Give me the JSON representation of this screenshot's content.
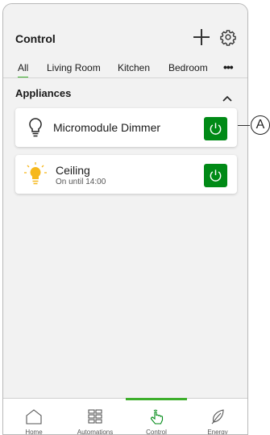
{
  "header": {
    "title": "Control"
  },
  "icons": {
    "add": "plus-icon",
    "settings": "gear-icon",
    "more": "more-dots-icon",
    "collapse": "chevron-up-icon"
  },
  "tabs": [
    {
      "label": "All",
      "active": true
    },
    {
      "label": "Living Room",
      "active": false
    },
    {
      "label": "Kitchen",
      "active": false
    },
    {
      "label": "Bedroom",
      "active": false
    }
  ],
  "tabs_more_label": "•••",
  "section": {
    "title": "Appliances"
  },
  "devices": [
    {
      "name": "Micromodule Dimmer",
      "status": "",
      "icon": "bulb-off-icon",
      "power": "on"
    },
    {
      "name": "Ceiling",
      "status": "On until 14:00",
      "icon": "bulb-on-icon",
      "power": "on"
    }
  ],
  "callout": {
    "label": "A"
  },
  "bottom_nav": [
    {
      "label": "Home",
      "icon": "home-icon",
      "active": false
    },
    {
      "label": "Automations",
      "icon": "grid-icon",
      "active": false
    },
    {
      "label": "Control",
      "icon": "hand-tap-icon",
      "active": true
    },
    {
      "label": "Energy",
      "icon": "leaf-icon",
      "active": false
    }
  ],
  "colors": {
    "accent": "#3dae2b",
    "power_button": "#008a16",
    "bulb_on": "#f6b81c"
  }
}
